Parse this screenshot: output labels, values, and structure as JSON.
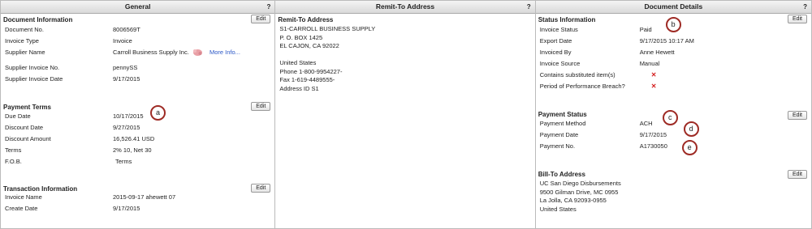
{
  "columns": {
    "general": {
      "title": "General",
      "help": "?"
    },
    "remit": {
      "title": "Remit-To Address",
      "help": "?"
    },
    "details": {
      "title": "Document Details",
      "help": "?"
    }
  },
  "edit_label": "Edit",
  "document_information": {
    "title": "Document Information",
    "rows": [
      {
        "label": "Document No.",
        "value": "8006569T"
      },
      {
        "label": "Invoice Type",
        "value": "Invoice"
      },
      {
        "label": "Supplier Name",
        "value": "Carroll Business Supply Inc.",
        "link": "More Info..."
      },
      {
        "label": "Supplier Invoice No.",
        "value": "pennySS"
      },
      {
        "label": "Supplier Invoice Date",
        "value": "9/17/2015"
      }
    ]
  },
  "payment_terms": {
    "title": "Payment Terms",
    "rows": [
      {
        "label": "Due Date",
        "value": "10/17/2015"
      },
      {
        "label": "Discount Date",
        "value": "9/27/2015"
      },
      {
        "label": "Discount Amount",
        "value": "16,526.41 USD"
      },
      {
        "label": "Terms",
        "value": "2% 10, Net 30"
      },
      {
        "label": "F.O.B.",
        "value": "Terms"
      }
    ]
  },
  "transaction_information": {
    "title": "Transaction Information",
    "rows": [
      {
        "label": "Invoice Name",
        "value": "2015-09-17 ahewett 07"
      },
      {
        "label": "Create Date",
        "value": "9/17/2015"
      }
    ]
  },
  "remit_to": {
    "title": "Remit-To Address",
    "lines": [
      "S1-CARROLL BUSINESS SUPPLY",
      "P. O. BOX 1425",
      "EL CAJON, CA 92022",
      "",
      "United States",
      "Phone 1-800-9954227-",
      "Fax 1-619-4489555-",
      "Address ID S1"
    ]
  },
  "status_information": {
    "title": "Status Information",
    "rows": [
      {
        "label": "Invoice Status",
        "value": "Paid"
      },
      {
        "label": "Export Date",
        "value": "9/17/2015 10:17 AM"
      },
      {
        "label": "Invoiced By",
        "value": "Anne Hewett"
      },
      {
        "label": "Invoice Source",
        "value": "Manual"
      },
      {
        "label": "Contains substituted item(s)",
        "value": "✕"
      },
      {
        "label": "Period of Performance Breach?",
        "value": "✕"
      }
    ]
  },
  "payment_status": {
    "title": "Payment Status",
    "rows": [
      {
        "label": "Payment Method",
        "value": "ACH"
      },
      {
        "label": "Payment Date",
        "value": "9/17/2015"
      },
      {
        "label": "Payment No.",
        "value": "A1730050"
      }
    ]
  },
  "bill_to": {
    "title": "Bill-To Address",
    "lines": [
      "UC San Diego Disbursements",
      "9500 Gilman Drive, MC 0955",
      "La Jolla, CA 92093-0955",
      "United States"
    ]
  },
  "callouts": [
    "a",
    "b",
    "c",
    "d",
    "e"
  ],
  "colors": {
    "callout_ring": "#9e2b25",
    "x_mark": "#d42020",
    "link": "#2a56c6"
  }
}
